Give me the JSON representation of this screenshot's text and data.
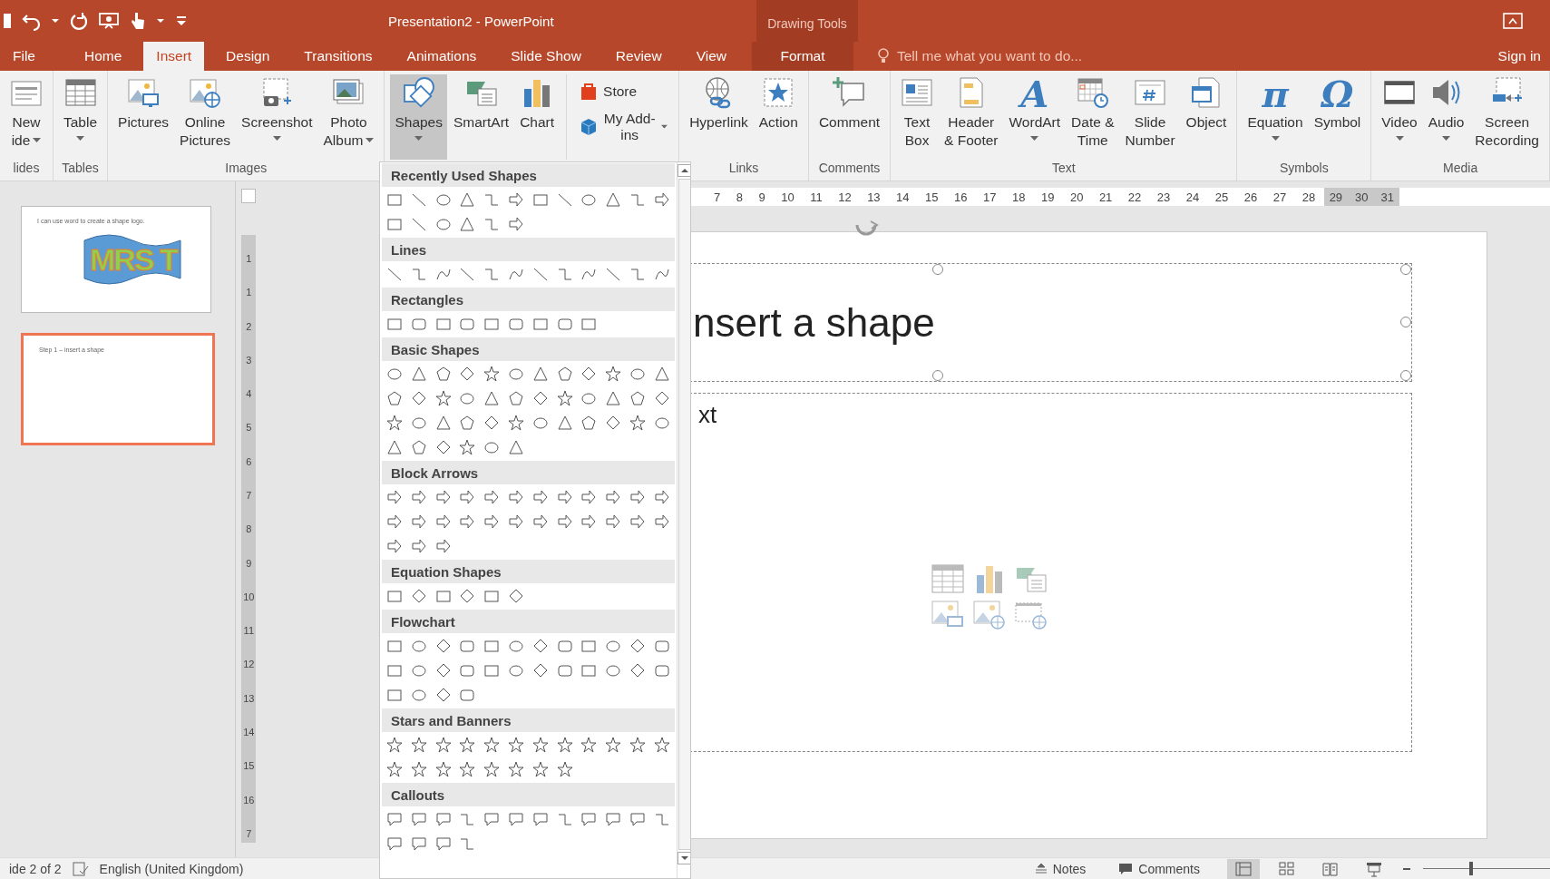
{
  "title_bar": {
    "title": "Presentation2 - PowerPoint",
    "contextual_label": "Drawing Tools"
  },
  "tabs": [
    {
      "label": "File",
      "selected": false,
      "kind": "normal"
    },
    {
      "label": "Home",
      "selected": false,
      "kind": "normal"
    },
    {
      "label": "Insert",
      "selected": true,
      "kind": "normal"
    },
    {
      "label": "Design",
      "selected": false,
      "kind": "normal"
    },
    {
      "label": "Transitions",
      "selected": false,
      "kind": "normal"
    },
    {
      "label": "Animations",
      "selected": false,
      "kind": "normal"
    },
    {
      "label": "Slide Show",
      "selected": false,
      "kind": "normal"
    },
    {
      "label": "Review",
      "selected": false,
      "kind": "normal"
    },
    {
      "label": "View",
      "selected": false,
      "kind": "normal"
    },
    {
      "label": "Format",
      "selected": false,
      "kind": "contextual"
    }
  ],
  "tell_me": {
    "placeholder": "Tell me what you want to do..."
  },
  "sign_in": "Sign in",
  "ribbon": {
    "groups": [
      {
        "label": "lides",
        "buttons": [
          {
            "label": "New\nide",
            "kind": "slide",
            "dropdown": true,
            "pressed": false
          }
        ]
      },
      {
        "label": "Tables",
        "buttons": [
          {
            "label": "Table",
            "kind": "table",
            "dropdown": true,
            "pressed": false
          }
        ]
      },
      {
        "label": "Images",
        "buttons": [
          {
            "label": "Pictures",
            "kind": "pictures",
            "dropdown": false,
            "pressed": false
          },
          {
            "label": "Online\nPictures",
            "kind": "online",
            "dropdown": false,
            "pressed": false
          },
          {
            "label": "Screenshot",
            "kind": "screenshot",
            "dropdown": true,
            "pressed": false
          },
          {
            "label": "Photo\nAlbum",
            "kind": "album",
            "dropdown": true,
            "pressed": false
          }
        ]
      },
      {
        "buttons": [
          {
            "label": "Shapes",
            "kind": "shapes",
            "dropdown": true,
            "pressed": true
          },
          {
            "label": "SmartArt",
            "kind": "smartart",
            "dropdown": false,
            "pressed": false
          },
          {
            "label": "Chart",
            "kind": "chart",
            "dropdown": false,
            "pressed": false
          }
        ],
        "small_buttons": [
          {
            "label": "Store",
            "kind": "store",
            "dropdown": false
          },
          {
            "label": "My Add-ins",
            "kind": "addins",
            "dropdown": true
          }
        ]
      },
      {
        "label": "Links",
        "buttons": [
          {
            "label": "Hyperlink",
            "kind": "hyperlink",
            "dropdown": false,
            "pressed": false
          },
          {
            "label": "Action",
            "kind": "action",
            "dropdown": false,
            "pressed": false
          }
        ]
      },
      {
        "label": "Comments",
        "buttons": [
          {
            "label": "Comment",
            "kind": "comment",
            "dropdown": false,
            "pressed": false
          }
        ]
      },
      {
        "label": "Text",
        "buttons": [
          {
            "label": "Text\nBox",
            "kind": "textbox",
            "dropdown": false,
            "pressed": false
          },
          {
            "label": "Header\n& Footer",
            "kind": "header",
            "dropdown": false,
            "pressed": false
          },
          {
            "label": "WordArt",
            "kind": "glyph",
            "glyph": "A",
            "dropdown": true,
            "pressed": false
          },
          {
            "label": "Date &\nTime",
            "kind": "datetime",
            "dropdown": false,
            "pressed": false
          },
          {
            "label": "Slide\nNumber",
            "kind": "number",
            "dropdown": false,
            "pressed": false
          },
          {
            "label": "Object",
            "kind": "object",
            "dropdown": false,
            "pressed": false
          }
        ]
      },
      {
        "label": "Symbols",
        "buttons": [
          {
            "label": "Equation",
            "kind": "glyph",
            "glyph": "π",
            "dropdown": true,
            "pressed": false
          },
          {
            "label": "Symbol",
            "kind": "glyph",
            "glyph": "Ω",
            "dropdown": false,
            "pressed": false
          }
        ]
      },
      {
        "label": "Media",
        "buttons": [
          {
            "label": "Video",
            "kind": "video",
            "dropdown": true,
            "pressed": false
          },
          {
            "label": "Audio",
            "kind": "audio",
            "dropdown": true,
            "pressed": false
          },
          {
            "label": "Screen\nRecording",
            "kind": "recording",
            "dropdown": false,
            "pressed": false
          }
        ]
      }
    ]
  },
  "slides": [
    {
      "text": "I can use word to create a shape logo.",
      "logo": "MRS T",
      "selected": false
    },
    {
      "text": "Step 1 – insert a shape",
      "selected": true
    }
  ],
  "vertical_ruler": {
    "labels": [
      "1",
      "1",
      "2",
      "3",
      "4",
      "5",
      "6",
      "7",
      "8",
      "9",
      "10",
      "11",
      "12",
      "13",
      "14",
      "15",
      "16",
      "7"
    ]
  },
  "horizontal_ruler": {
    "labels": [
      "7",
      "8",
      "9",
      "10",
      "11",
      "12",
      "13",
      "14",
      "15",
      "16",
      "17",
      "18",
      "19",
      "20",
      "21",
      "22",
      "23",
      "24",
      "25",
      "26",
      "27",
      "28"
    ],
    "outside_labels": [
      "29",
      "30",
      "31"
    ]
  },
  "slide": {
    "title": "nsert a shape",
    "body": "xt"
  },
  "shapes_gallery": {
    "sections": [
      {
        "title": "Recently Used Shapes"
      },
      {
        "title": "Lines"
      },
      {
        "title": "Rectangles"
      },
      {
        "title": "Basic Shapes"
      },
      {
        "title": "Block Arrows"
      },
      {
        "title": "Equation Shapes"
      },
      {
        "title": "Flowchart"
      },
      {
        "title": "Stars and Banners"
      },
      {
        "title": "Callouts"
      }
    ]
  },
  "status_bar": {
    "slide_indicator": "ide 2 of 2",
    "language": "English (United Kingdom)",
    "notes": "Notes",
    "comments": "Comments",
    "views": [
      {
        "selected": true
      },
      {
        "selected": false
      },
      {
        "selected": false
      },
      {
        "selected": false
      }
    ],
    "zoom": {
      "level": 0.38
    }
  }
}
